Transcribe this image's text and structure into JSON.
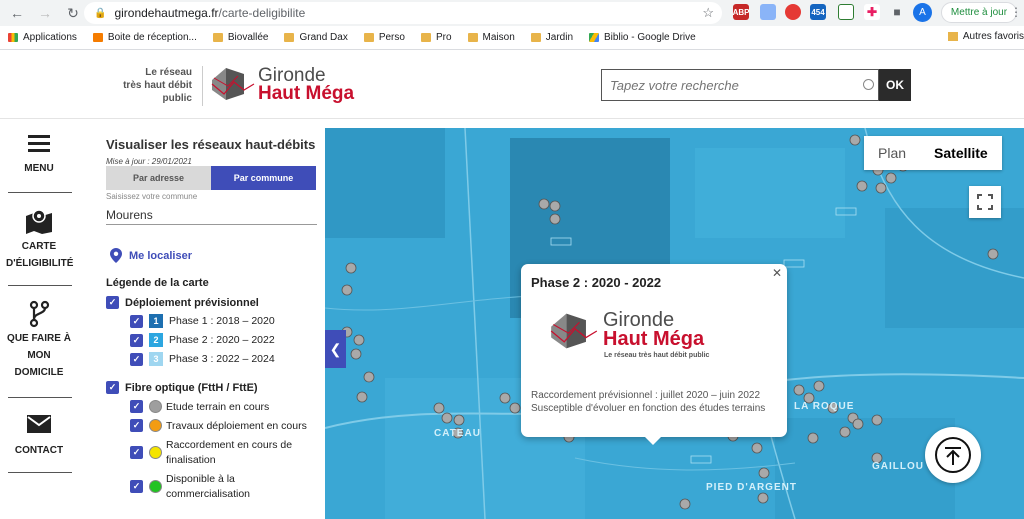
{
  "browser": {
    "url_host": "girondehautmega.fr",
    "url_path": "/carte-deligibilite",
    "avatar_letter": "A",
    "update_label": "Mettre à jour",
    "extensions": [
      "ABP",
      "454"
    ]
  },
  "bookmarks": {
    "items": [
      "Applications",
      "Boite de réception...",
      "Biovallée",
      "Grand Dax",
      "Perso",
      "Pro",
      "Maison",
      "Jardin",
      "Biblio - Google Drive"
    ],
    "other": "Autres favoris"
  },
  "header": {
    "tagline_1": "Le réseau",
    "tagline_2": "très haut débit",
    "tagline_3": "public",
    "logo_line1": "Gironde",
    "logo_line2": "Haut Méga",
    "search_placeholder": "Tapez votre recherche",
    "search_button": "OK"
  },
  "leftnav": {
    "menu": "MENU",
    "carte_1": "CARTE",
    "carte_2": "D'ÉLIGIBILITÉ",
    "quefaire_1": "QUE FAIRE À",
    "quefaire_2": "MON",
    "quefaire_3": "DOMICILE",
    "contact": "CONTACT"
  },
  "panel": {
    "title": "Visualiser les réseaux haut-débits",
    "updated": "Mise à jour : 29/01/2021",
    "tab_address": "Par adresse",
    "tab_commune": "Par commune",
    "city_label": "Saisissez votre commune",
    "city_value": "Mourens",
    "locate": "Me localiser",
    "legend_title": "Légende de la carte",
    "deploy_group": "Déploiement prévisionnel",
    "phases": [
      {
        "num": "1",
        "label": "Phase 1 : 2018 – 2020",
        "color": "#1d6fb0"
      },
      {
        "num": "2",
        "label": "Phase 2 : 2020 – 2022",
        "color": "#2ca6e0"
      },
      {
        "num": "3",
        "label": "Phase 3 : 2022 – 2024",
        "color": "#9fd6f0"
      }
    ],
    "fibre_group": "Fibre optique (FttH / FttE)",
    "fibre_items": [
      {
        "line1": "Etude terrain en cours",
        "line2": "",
        "color": "#9e9e9e"
      },
      {
        "line1": "Travaux déploiement en cours",
        "line2": "",
        "color": "#f39c12"
      },
      {
        "line1": "Raccordement en cours de",
        "line2": "finalisation",
        "color": "#f4e400"
      },
      {
        "line1": "Disponible à la",
        "line2": "commercialisation",
        "color": "#22c322"
      }
    ]
  },
  "map": {
    "type_plan": "Plan",
    "type_satellite": "Satellite",
    "labels": [
      "CATEAU",
      "PIED D'ARGENT",
      "LA ROQUE",
      "GAILLOU"
    ]
  },
  "popup": {
    "title": "Phase 2 : 2020 - 2022",
    "logo_line1": "Gironde",
    "logo_line2": "Haut Méga",
    "logo_sub": "Le réseau très haut débit public",
    "line1": "Raccordement prévisionnel : juillet 2020 – juin 2022",
    "line2": "Susceptible d'évoluer en fonction des études terrains"
  }
}
